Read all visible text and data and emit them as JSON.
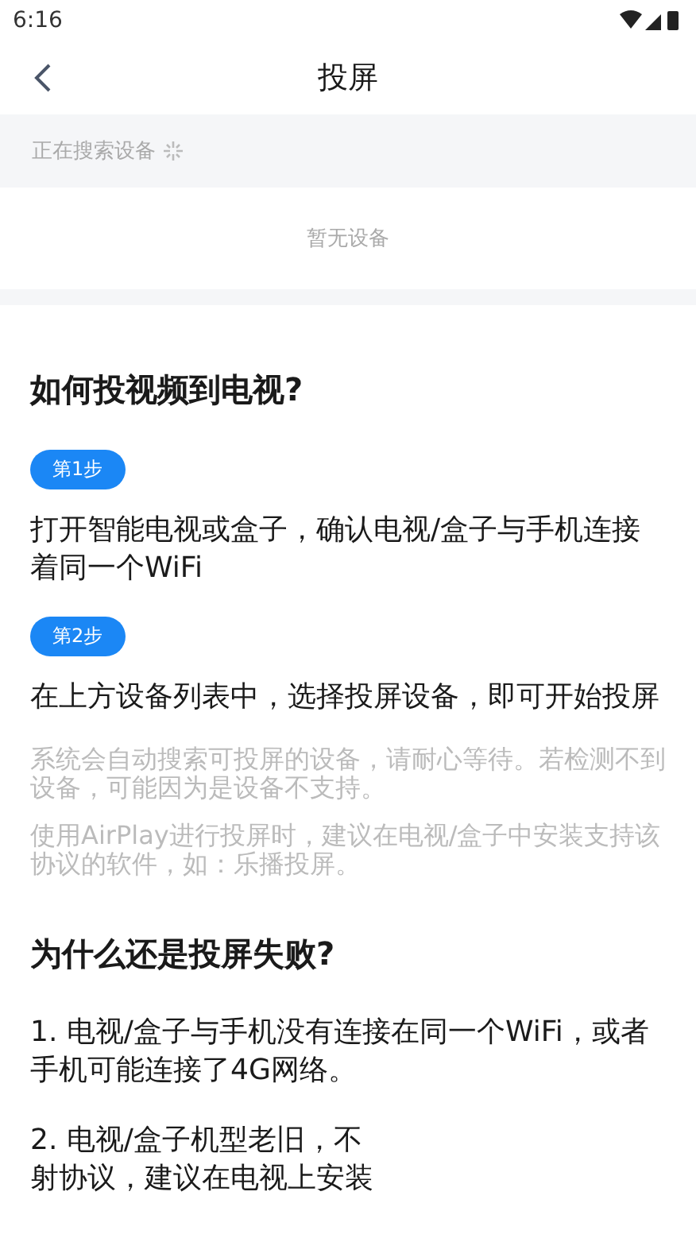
{
  "status_bar": {
    "time": "6:16"
  },
  "header": {
    "title": "投屏"
  },
  "search": {
    "text": "正在搜索设备",
    "searching": true
  },
  "empty_text": "暂无设备",
  "guide": {
    "title": "如何投视频到电视?",
    "steps": [
      {
        "badge": "第1步",
        "text": "打开智能电视或盒子，确认电视/盒子与手机连接着同一个WiFi"
      },
      {
        "badge": "第2步",
        "text": "在上方设备列表中，选择投屏设备，即可开始投屏"
      }
    ],
    "notes": [
      "系统会自动搜索可投屏的设备，请耐心等待。若检测不到设备，可能因为是设备不支持。",
      "使用AirPlay进行投屏时，建议在电视/盒子中安装支持该协议的软件，如：乐播投屏。"
    ]
  },
  "failure": {
    "title": "为什么还是投屏失败?",
    "items": [
      {
        "lines": [
          "1. 电视/盒子与手机没有连接在同一个WiFi，或者手机可能连接了4G网络。"
        ]
      },
      {
        "lines": [
          "2. 电视/盒子机型老旧，不",
          "射协议，建议在电视上安装"
        ]
      }
    ]
  }
}
